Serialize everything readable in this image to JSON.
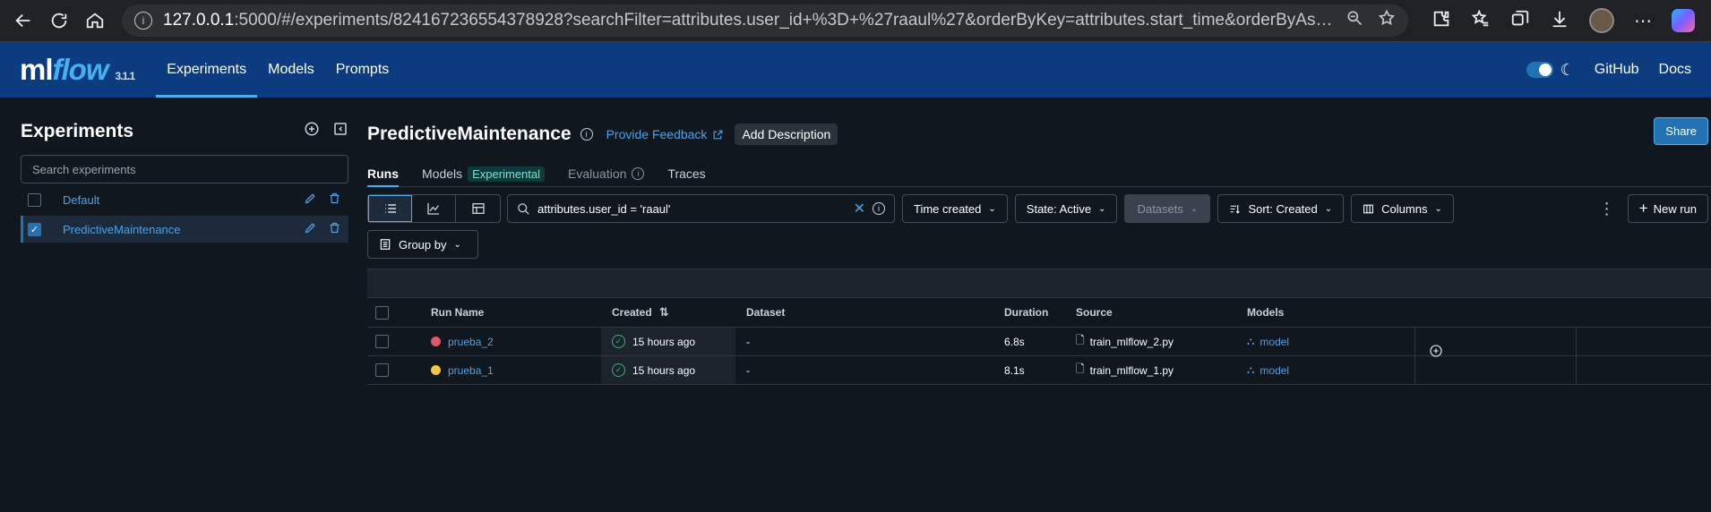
{
  "browser": {
    "url_host": "127.0.0.1",
    "url_rest": ":5000/#/experiments/824167236554378928?searchFilter=attributes.user_id+%3D+%27raaul%27&orderByKey=attributes.start_time&orderByAsc=false&startTi..."
  },
  "header": {
    "logo_ml": "ml",
    "logo_flow": "flow",
    "version": "3.1.1",
    "nav": [
      "Experiments",
      "Models",
      "Prompts"
    ],
    "active_nav": "Experiments",
    "github": "GitHub",
    "docs": "Docs",
    "theme_icon": "moon-icon"
  },
  "sidebar": {
    "title": "Experiments",
    "search_placeholder": "Search experiments",
    "items": [
      {
        "label": "Default",
        "checked": false
      },
      {
        "label": "PredictiveMaintenance",
        "checked": true
      }
    ]
  },
  "experiment": {
    "title": "PredictiveMaintenance",
    "feedback": "Provide Feedback",
    "add_description": "Add Description",
    "share": "Share"
  },
  "tabs": {
    "runs": "Runs",
    "models": "Models",
    "models_badge": "Experimental",
    "evaluation": "Evaluation",
    "traces": "Traces"
  },
  "toolbar": {
    "filter_query": "attributes.user_id = 'raaul'",
    "time_created": "Time created",
    "state": "State: Active",
    "datasets": "Datasets",
    "sort": "Sort: Created",
    "columns": "Columns",
    "new_run": "New run",
    "group_by": "Group by"
  },
  "table": {
    "headers": {
      "run_name": "Run Name",
      "created": "Created",
      "dataset": "Dataset",
      "duration": "Duration",
      "source": "Source",
      "models": "Models"
    },
    "rows": [
      {
        "name": "prueba_2",
        "color": "#e0566b",
        "created": "15 hours ago",
        "dataset": "-",
        "duration": "6.8s",
        "source": "train_mlflow_2.py",
        "model": "model"
      },
      {
        "name": "prueba_1",
        "color": "#f2c744",
        "created": "15 hours ago",
        "dataset": "-",
        "duration": "8.1s",
        "source": "train_mlflow_1.py",
        "model": "model"
      }
    ]
  }
}
